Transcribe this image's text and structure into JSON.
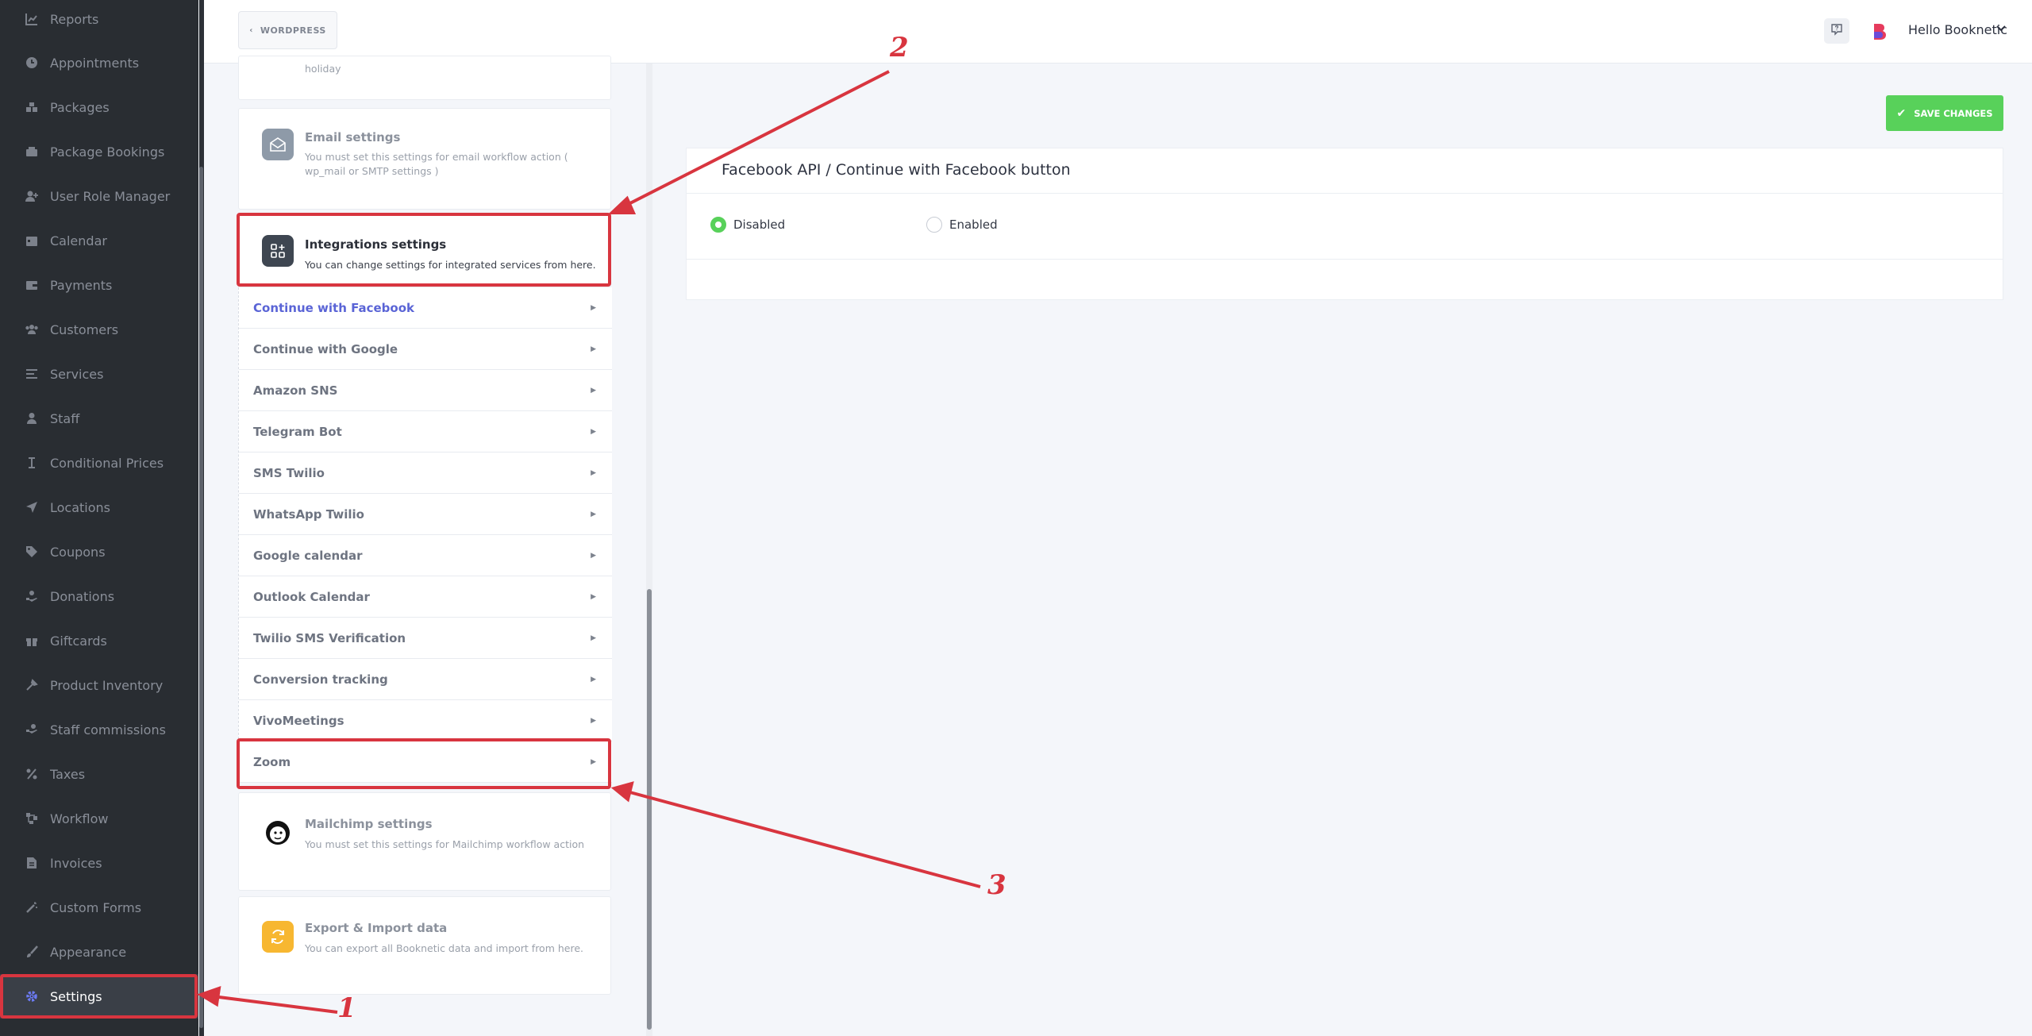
{
  "sidebar": {
    "items": [
      {
        "label": "Reports",
        "icon": "chart-icon"
      },
      {
        "label": "Appointments",
        "icon": "clock-icon"
      },
      {
        "label": "Packages",
        "icon": "boxes-icon"
      },
      {
        "label": "Package Bookings",
        "icon": "package-bookings-icon"
      },
      {
        "label": "User Role Manager",
        "icon": "user-role-icon"
      },
      {
        "label": "Calendar",
        "icon": "calendar-icon"
      },
      {
        "label": "Payments",
        "icon": "payments-icon"
      },
      {
        "label": "Customers",
        "icon": "customers-icon"
      },
      {
        "label": "Services",
        "icon": "services-icon"
      },
      {
        "label": "Staff",
        "icon": "staff-icon"
      },
      {
        "label": "Conditional Prices",
        "icon": "conditional-prices-icon"
      },
      {
        "label": "Locations",
        "icon": "location-arrow-icon"
      },
      {
        "label": "Coupons",
        "icon": "tag-icon"
      },
      {
        "label": "Donations",
        "icon": "donations-icon"
      },
      {
        "label": "Giftcards",
        "icon": "gift-icon"
      },
      {
        "label": "Product Inventory",
        "icon": "inventory-icon"
      },
      {
        "label": "Staff commissions",
        "icon": "commissions-icon"
      },
      {
        "label": "Taxes",
        "icon": "percent-icon"
      },
      {
        "label": "Workflow",
        "icon": "workflow-icon"
      },
      {
        "label": "Invoices",
        "icon": "invoice-icon"
      },
      {
        "label": "Custom Forms",
        "icon": "magic-wand-icon"
      },
      {
        "label": "Appearance",
        "icon": "brush-icon"
      },
      {
        "label": "Settings",
        "icon": "gear-icon",
        "active": true
      }
    ]
  },
  "topbar": {
    "back_label": "WORDPRESS",
    "user_greeting": "Hello Booknetic"
  },
  "settings_cards": {
    "holiday_tail": "holiday",
    "email": {
      "title": "Email settings",
      "desc": "You must set this settings for email workflow action ( wp_mail or SMTP settings )"
    },
    "integrations": {
      "title": "Integrations settings",
      "desc": "You can change settings for integrated services from here."
    },
    "mailchimp": {
      "title": "Mailchimp settings",
      "desc": "You must set this settings for Mailchimp workflow action"
    },
    "export": {
      "title": "Export & Import data",
      "desc": "You can export all Booknetic data and import from here."
    }
  },
  "integration_items": [
    {
      "label": "Continue with Facebook",
      "active": true
    },
    {
      "label": "Continue with Google"
    },
    {
      "label": "Amazon SNS"
    },
    {
      "label": "Telegram Bot"
    },
    {
      "label": "SMS Twilio"
    },
    {
      "label": "WhatsApp Twilio"
    },
    {
      "label": "Google calendar"
    },
    {
      "label": "Outlook Calendar"
    },
    {
      "label": "Twilio SMS Verification"
    },
    {
      "label": "Conversion tracking"
    },
    {
      "label": "VivoMeetings"
    },
    {
      "label": "Zoom"
    }
  ],
  "main": {
    "save_label": "SAVE CHANGES",
    "panel_title": "Facebook API / Continue with Facebook button",
    "options": {
      "disabled": "Disabled",
      "enabled": "Enabled",
      "selected": "Disabled"
    }
  },
  "annotations": {
    "step1": "1",
    "step2": "2",
    "step3": "3",
    "color": "#d8353f"
  },
  "colors": {
    "sidebar_bg": "#292d32",
    "accent": "#5a64d6",
    "save_green": "#58d15a"
  }
}
